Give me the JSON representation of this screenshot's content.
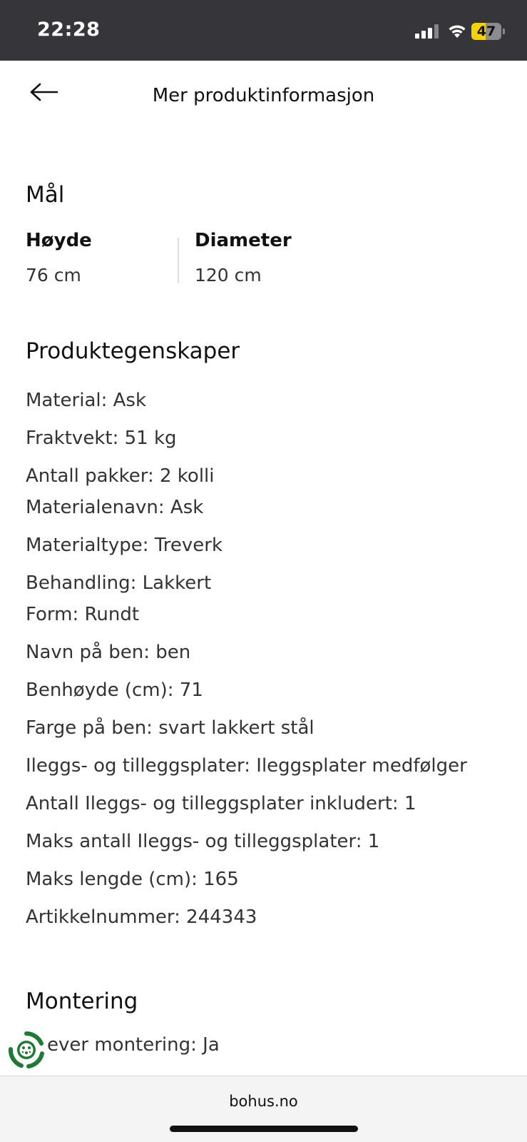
{
  "status_bar": {
    "time": "22:28",
    "battery_level": "47",
    "icons": [
      "signal-icon",
      "wifi-icon",
      "battery-icon"
    ]
  },
  "header": {
    "title": "Mer produktinformasjon",
    "back_icon": "arrow-left-icon"
  },
  "dimensions": {
    "heading": "Mål",
    "items": [
      {
        "label": "Høyde",
        "value": "76 cm"
      },
      {
        "label": "Diameter",
        "value": "120 cm"
      }
    ]
  },
  "properties": {
    "heading": "Produktegenskaper",
    "items": [
      "Material: Ask",
      "Fraktvekt: 51 kg",
      "Antall pakker: 2 kolli",
      "Materialenavn: Ask",
      "Materialtype: Treverk",
      "Behandling: Lakkert",
      "Form: Rundt",
      "Navn på ben: ben",
      "Benhøyde (cm): 71",
      "Farge på ben: svart lakkert stål",
      "Ileggs- og tilleggsplater: Ileggsplater medfølger",
      "Antall Ileggs- og tilleggsplater inkludert: 1",
      "Maks antall Ileggs- og tilleggsplater: 1",
      "Maks lengde (cm): 165",
      "Artikkelnummer: 244343"
    ]
  },
  "assembly": {
    "heading": "Montering",
    "items": [
      "ever montering: Ja"
    ]
  },
  "browser": {
    "url": "bohus.no"
  },
  "colors": {
    "status_bar_bg": "#36363a",
    "battery_fill": "#f5d300",
    "eco_badge_green": "#1f7a35"
  }
}
